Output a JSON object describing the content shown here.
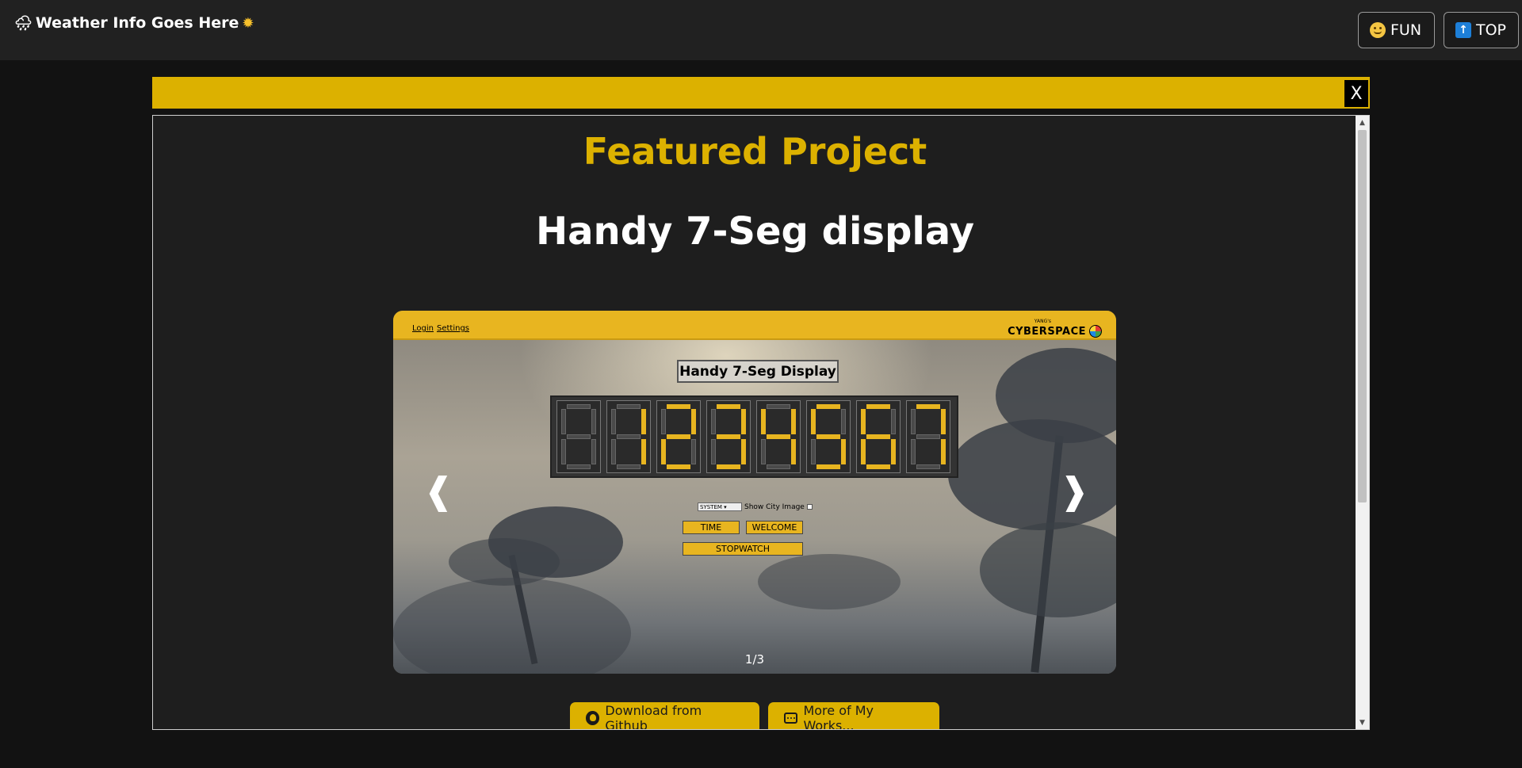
{
  "header": {
    "weather_text": "Weather Info Goes Here",
    "weather_icon_left": "rain-cloud-icon",
    "weather_icon_right": "sun-icon",
    "fun_label": "FUN",
    "top_label": "TOP"
  },
  "modal": {
    "close_label": "X",
    "heading": "Featured Project",
    "project_title": "Handy 7-Seg display",
    "accent_color": "#dcb100"
  },
  "carousel": {
    "counter": "1/3",
    "prev_symbol": "❰",
    "next_symbol": "❱",
    "slide": {
      "links": [
        "Login",
        "Settings"
      ],
      "brand_small": "YANG's",
      "brand_big": "CYBERSPACE",
      "display_title": "Handy 7-Seg Display",
      "select_value": "SYSTEM",
      "show_city_label": "Show City Image",
      "buttons": {
        "time": "TIME",
        "welcome": "WELCOME",
        "stopwatch": "STOPWATCH"
      }
    }
  },
  "actions": {
    "github_label": "Download from Github",
    "works_label": "More of My Works..."
  }
}
